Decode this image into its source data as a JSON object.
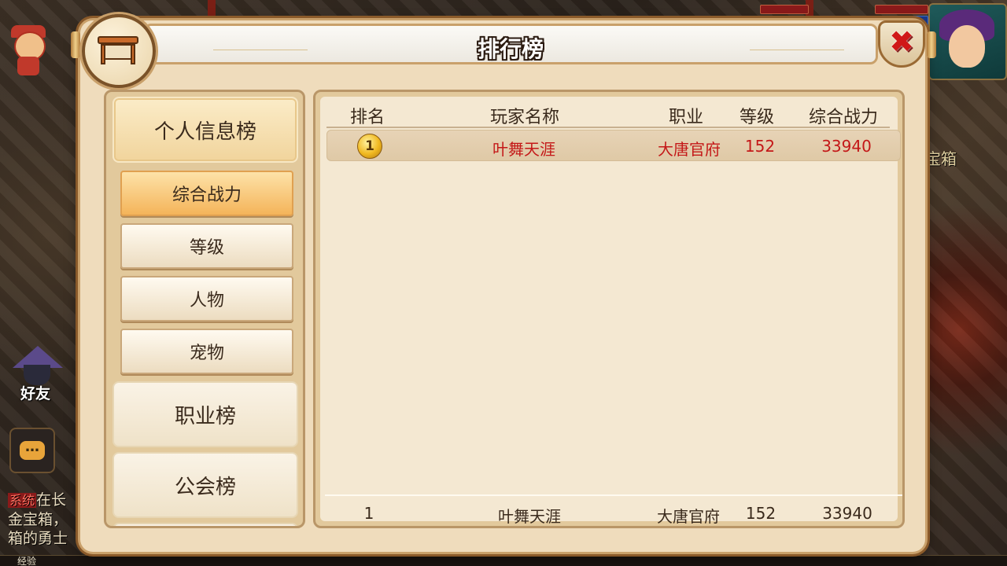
{
  "dialog": {
    "title": "排行榜",
    "close_label": "✖"
  },
  "categories": [
    {
      "label": "个人信息榜"
    },
    {
      "label": "职业榜"
    },
    {
      "label": "公会榜"
    }
  ],
  "subcategories": [
    {
      "label": "综合战力"
    },
    {
      "label": "等级"
    },
    {
      "label": "人物"
    },
    {
      "label": "宠物"
    }
  ],
  "table": {
    "headers": [
      "排名",
      "玩家名称",
      "职业",
      "等级",
      "综合战力"
    ],
    "rows": [
      {
        "rank": "1",
        "name": "叶舞天涯",
        "profession": "大唐官府",
        "level": "152",
        "power": "33940"
      }
    ],
    "my_row": {
      "rank": "1",
      "name": "叶舞天涯",
      "profession": "大唐官府",
      "level": "152",
      "power": "33940"
    }
  },
  "background": {
    "friend_label": "好友",
    "chat_icon": "…",
    "sys_tag": "系统",
    "sys_line1": "在长",
    "sys_line2": "金宝箱，",
    "sys_line3": "箱的勇士",
    "xp_label": "经验",
    "right_text": "宝箱"
  },
  "colors": {
    "highlight_text": "#c41818",
    "active_tab": "#f4b45a",
    "panel": "#efdcbc"
  }
}
